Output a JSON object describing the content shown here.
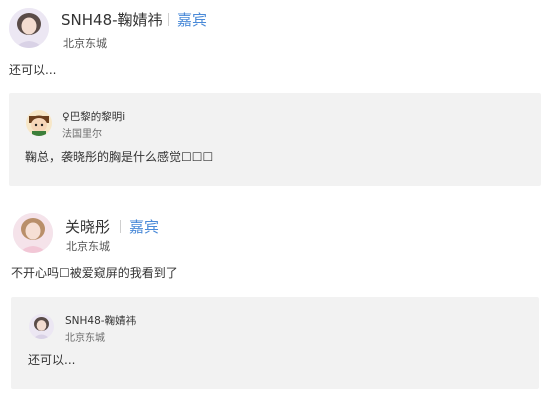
{
  "posts": [
    {
      "author": "SNH48-鞠婧祎",
      "badge": "嘉宾",
      "location": "北京东城",
      "text": "还可以...",
      "quote": {
        "author": "♀巴黎的黎明i",
        "location": "法国里尔",
        "text": "鞠总，袭晓彤的胸是什么感觉☐☐☐"
      }
    },
    {
      "author": "关晓彤",
      "badge": "嘉宾",
      "location": "北京东城",
      "text": "不开心吗☐被爱窥屏的我看到了",
      "quote": {
        "author": "SNH48-鞠婧祎",
        "location": "北京东城",
        "text": "还可以..."
      }
    }
  ],
  "colors": {
    "badge": "#4a8ad8",
    "quote_bg": "#f2f2f2",
    "text": "#333333"
  },
  "icons": {
    "post_1_avatar": "profile-photo",
    "post_1_quote_avatar": "cartoon-character-icon",
    "post_2_avatar": "profile-photo",
    "post_2_quote_avatar": "profile-photo"
  }
}
